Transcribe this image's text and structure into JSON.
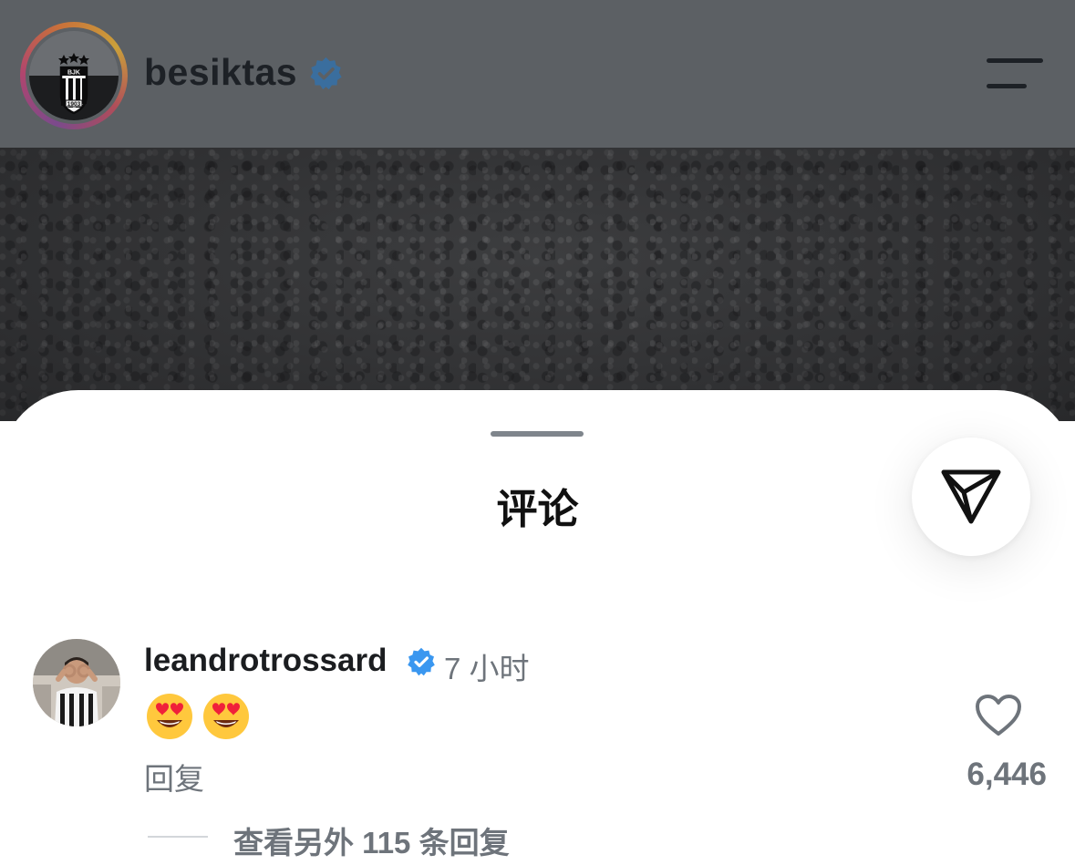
{
  "header": {
    "username": "besiktas",
    "verified": true,
    "crest_text": {
      "letters": "BJK",
      "year": "1903"
    }
  },
  "sheet": {
    "title": "评论"
  },
  "comment": {
    "username": "leandrotrossard",
    "verified": true,
    "time": "7 小时",
    "text": "😍😍",
    "reply_label": "回复",
    "likes": "6,446",
    "more_replies": "查看另外 115 条回复"
  },
  "icons": {
    "header_menu": "hamburger-menu-icon",
    "share": "send-icon",
    "like": "heart-outline-icon",
    "verified": "verified-badge-icon"
  },
  "colors": {
    "verified_blue": "#3a97f0",
    "header_dim": "#5c6064",
    "muted_text": "#6e747b"
  }
}
